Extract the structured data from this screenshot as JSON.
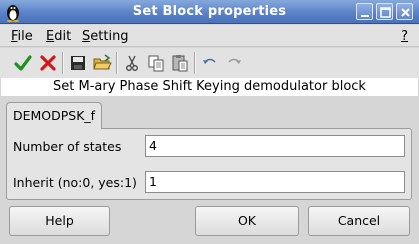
{
  "window": {
    "title": "Set Block properties"
  },
  "menubar": {
    "file_label": "File",
    "edit_label": "Edit",
    "setting_label": "Setting",
    "help_label": "?"
  },
  "toolbar": {
    "buttons": [
      "check-icon",
      "cross-icon",
      "save-icon",
      "open-folder-icon",
      "cut-icon",
      "copy-icon",
      "paste-icon",
      "undo-icon",
      "redo-icon"
    ]
  },
  "description": "Set M-ary Phase Shift Keying demodulator block",
  "tab": {
    "label": "DEMODPSK_f"
  },
  "fields": [
    {
      "label": "Number of states",
      "value": "4"
    },
    {
      "label": "Inherit (no:0, yes:1)",
      "value": "1"
    }
  ],
  "buttons": {
    "help_label": "Help",
    "ok_label": "OK",
    "cancel_label": "Cancel"
  },
  "colors": {
    "titlebar": "#5b82c8",
    "accept": "#1f8f1f",
    "reject": "#d01818"
  }
}
